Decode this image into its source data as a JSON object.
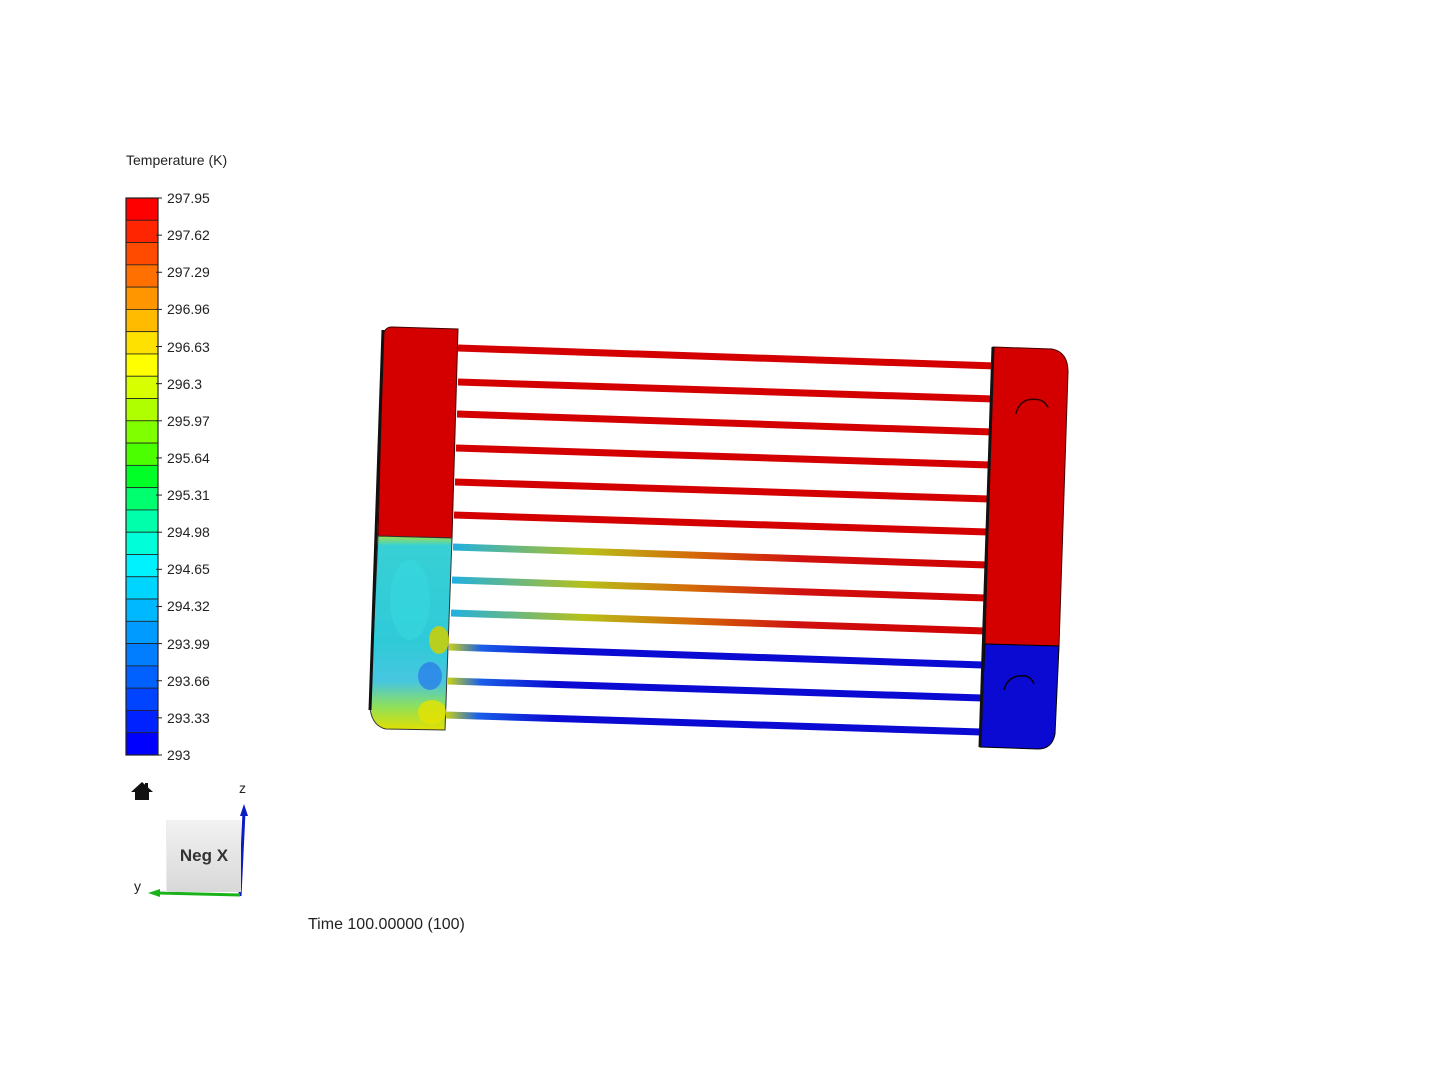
{
  "legend": {
    "title": "Temperature (K)",
    "ticks": [
      "297.95",
      "297.62",
      "297.29",
      "296.96",
      "296.63",
      "296.3",
      "295.97",
      "295.64",
      "295.31",
      "294.98",
      "294.65",
      "294.32",
      "293.99",
      "293.66",
      "293.33",
      "293"
    ],
    "colors": [
      "#ff0000",
      "#ff2500",
      "#ff4b00",
      "#ff7000",
      "#ff9600",
      "#ffbb00",
      "#ffe100",
      "#ffff00",
      "#d8ff00",
      "#b0ff00",
      "#7fff00",
      "#4cff00",
      "#00ff26",
      "#00ff6e",
      "#00ffab",
      "#00ffd9",
      "#00f2ff",
      "#00d5ff",
      "#00b8ff",
      "#009bff",
      "#007eff",
      "#0061ff",
      "#0044ff",
      "#0022ff",
      "#0000ff"
    ]
  },
  "orientation": {
    "face_label": "Neg X",
    "axis_z": "z",
    "axis_y": "y"
  },
  "time": {
    "label": "Time 100.00000 (100)"
  },
  "colors": {
    "hot": "#d40000",
    "cold": "#0a0ad2",
    "mid": "#2fd0d8",
    "z_axis": "#0b1cc4",
    "y_axis": "#19b319"
  },
  "icons": {
    "home": "home-icon"
  }
}
